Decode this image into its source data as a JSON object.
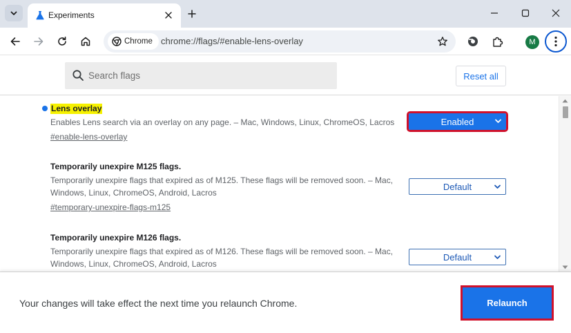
{
  "browser": {
    "tab": {
      "title": "Experiments"
    },
    "chip_label": "Chrome",
    "url": "chrome://flags/#enable-lens-overlay",
    "profile_initial": "M",
    "icons": {
      "tab_search": "chevron-down-icon",
      "favicon": "flask-icon",
      "close_tab": "close-icon",
      "new_tab": "plus-icon",
      "minimize": "minimize-icon",
      "maximize": "maximize-icon",
      "close_window": "close-icon",
      "back": "arrow-left-icon",
      "forward": "arrow-right-icon",
      "reload": "reload-icon",
      "home": "home-icon",
      "bookmark": "star-icon",
      "extension_lens": "lens-icon",
      "extensions": "puzzle-icon",
      "menu": "kebab-icon"
    },
    "colors": {
      "tabstrip": "#dee3eb",
      "accent": "#1a73e8",
      "highlight_box": "#d0112b",
      "title_highlight": "#f6f100",
      "avatar": "#177a45"
    }
  },
  "flags_header": {
    "search_placeholder": "Search flags",
    "reset_label": "Reset all"
  },
  "flags": [
    {
      "title": "Lens overlay",
      "highlighted": true,
      "modified": true,
      "description": "Enables Lens search via an overlay on any page. – Mac, Windows, Linux, ChromeOS, Lacros",
      "link": "#enable-lens-overlay",
      "value": "Enabled"
    },
    {
      "title": "Temporarily unexpire M125 flags.",
      "highlighted": false,
      "modified": false,
      "description": "Temporarily unexpire flags that expired as of M125. These flags will be removed soon. – Mac, Windows, Linux, ChromeOS, Android, Lacros",
      "link": "#temporary-unexpire-flags-m125",
      "value": "Default"
    },
    {
      "title": "Temporarily unexpire M126 flags.",
      "highlighted": false,
      "modified": false,
      "description": "Temporarily unexpire flags that expired as of M126. These flags will be removed soon. – Mac, Windows, Linux, ChromeOS, Android, Lacros",
      "link": "",
      "value": "Default"
    }
  ],
  "relaunch": {
    "message": "Your changes will take effect the next time you relaunch Chrome.",
    "button_label": "Relaunch"
  }
}
